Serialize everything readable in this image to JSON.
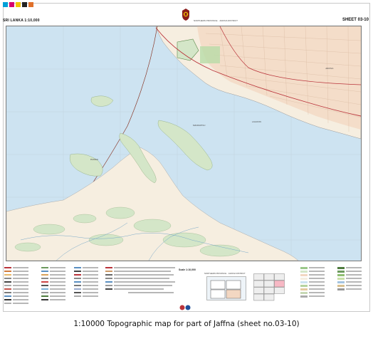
{
  "colors": {
    "sea": "#cde3f1",
    "land": "#f6eee0",
    "vegetation": "#d4e6c8",
    "built_up": "#f3d7c2",
    "main_road": "#b9333a",
    "grid": "#bfcfdc",
    "sheet_border": "#777777"
  },
  "header": {
    "title": "SRI LANKA 1:10,000",
    "center_text": "NORTHERN PROVINCE · JAFFNA DISTRICT",
    "sheet_label": "SHEET 03-10"
  },
  "map": {
    "labels": [
      "JAFFNA",
      "LAGOON",
      "MANDATIVU",
      "PANNAI"
    ]
  },
  "legend": {
    "scale": "Scale 1:10,000",
    "location": "NORTHERN PROVINCE · JAFFNA DISTRICT",
    "sheet_index": [
      "03-01",
      "03-02",
      "03-03",
      "03-04",
      "03-05",
      "03-06",
      "03-07",
      "03-08",
      "03-09",
      "03-10",
      "03-11",
      "03-12"
    ]
  },
  "caption": "1:10000  Topographic map for part of Jaffna (sheet no.03-10)"
}
